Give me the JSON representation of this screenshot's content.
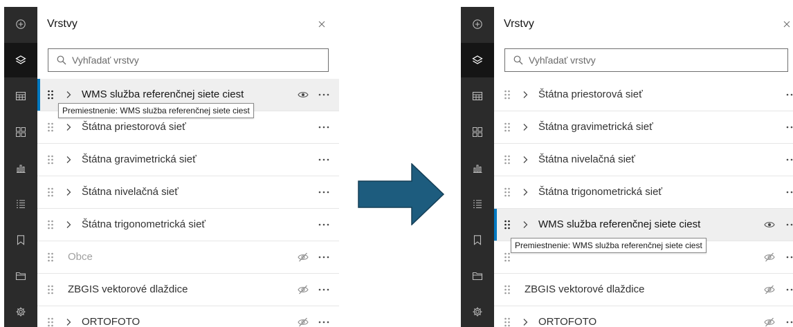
{
  "colors": {
    "rail": "#2b2b2b",
    "rail_active": "#151515",
    "selected_accent": "#0079c1",
    "arrow_fill": "#1d5c7e",
    "arrow_stroke": "#153f57"
  },
  "rail": [
    {
      "icon": "add-icon"
    },
    {
      "icon": "layers-icon",
      "active": true
    },
    {
      "icon": "table-icon"
    },
    {
      "icon": "basemap-icon"
    },
    {
      "icon": "chart-icon"
    },
    {
      "icon": "legend-icon"
    },
    {
      "icon": "bookmark-icon"
    },
    {
      "icon": "folder-icon"
    },
    {
      "icon": "gear-icon"
    }
  ],
  "panels": {
    "before": {
      "title": "Vrstvy",
      "search_placeholder": "Vyhľadať vrstvy",
      "layers": [
        {
          "name": "WMS služba referenčnej siete ciest",
          "expandable": true,
          "visibility": "visible",
          "selected": true
        },
        {
          "name": "Štátna priestorová sieť",
          "expandable": true
        },
        {
          "name": "Štátna gravimetrická sieť",
          "expandable": true
        },
        {
          "name": "Štátna nivelačná sieť",
          "expandable": true
        },
        {
          "name": "Štátna trigonometrická sieť",
          "expandable": true
        },
        {
          "name": "Obce",
          "expandable": false,
          "visibility": "hidden",
          "dimmed": true
        },
        {
          "name": "ZBGIS vektorové dlaždice",
          "expandable": false,
          "visibility": "hidden"
        },
        {
          "name": "ORTOFOTO",
          "expandable": true,
          "visibility": "hidden"
        }
      ],
      "tooltip": "Premiestnenie: WMS služba referenčnej siete ciest"
    },
    "after": {
      "title": "Vrstvy",
      "search_placeholder": "Vyhľadať vrstvy",
      "layers": [
        {
          "name": "Štátna priestorová sieť",
          "expandable": true
        },
        {
          "name": "Štátna gravimetrická sieť",
          "expandable": true
        },
        {
          "name": "Štátna nivelačná sieť",
          "expandable": true
        },
        {
          "name": "Štátna trigonometrická sieť",
          "expandable": true
        },
        {
          "name": "WMS služba referenčnej siete ciest",
          "expandable": true,
          "visibility": "visible",
          "selected": true
        },
        {
          "name": "",
          "expandable": false,
          "visibility": "hidden"
        },
        {
          "name": "ZBGIS vektorové dlaždice",
          "expandable": false,
          "visibility": "hidden"
        },
        {
          "name": "ORTOFOTO",
          "expandable": true,
          "visibility": "hidden"
        }
      ],
      "tooltip": "Premiestnenie: WMS služba referenčnej siete ciest"
    }
  }
}
